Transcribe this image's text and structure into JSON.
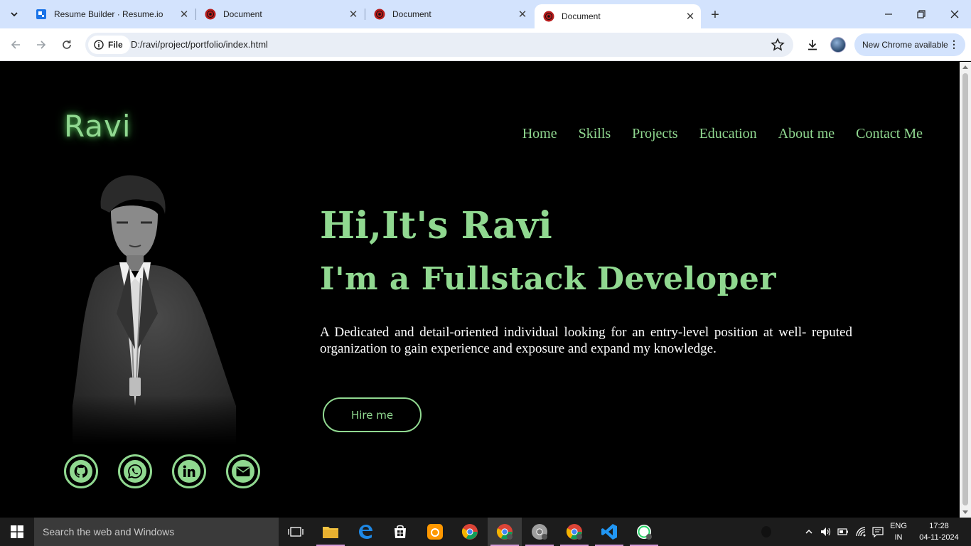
{
  "browser": {
    "tabs": [
      {
        "title": "Resume Builder · Resume.io",
        "favicon": "resume-io-icon",
        "active": false
      },
      {
        "title": "Document",
        "favicon": "sharingan-icon",
        "active": false
      },
      {
        "title": "Document",
        "favicon": "sharingan-icon",
        "active": false
      },
      {
        "title": "Document",
        "favicon": "sharingan-icon",
        "active": true
      }
    ],
    "site_chip": "File",
    "url": "D:/ravi/project/portfolio/index.html",
    "update_label": "New Chrome available"
  },
  "page": {
    "logo": "Ravi",
    "nav": [
      "Home",
      "Skills",
      "Projects",
      "Education",
      "About me",
      "Contact Me"
    ],
    "hero_title": "Hi,It's Ravi",
    "hero_subtitle": "I'm a Fullstack Developer",
    "description": "A Dedicated and detail-oriented individual looking for an entry-level position at well- reputed organization to gain experience and exposure and expand my knowledge.",
    "hire_button": "Hire me",
    "social": [
      "github-icon",
      "whatsapp-icon",
      "linkedin-icon",
      "email-icon"
    ],
    "accent_color": "#90d890"
  },
  "taskbar": {
    "search_placeholder": "Search the web and Windows",
    "lang_line1": "ENG",
    "lang_line2": "IN",
    "time": "17:28",
    "date": "04-11-2024"
  }
}
